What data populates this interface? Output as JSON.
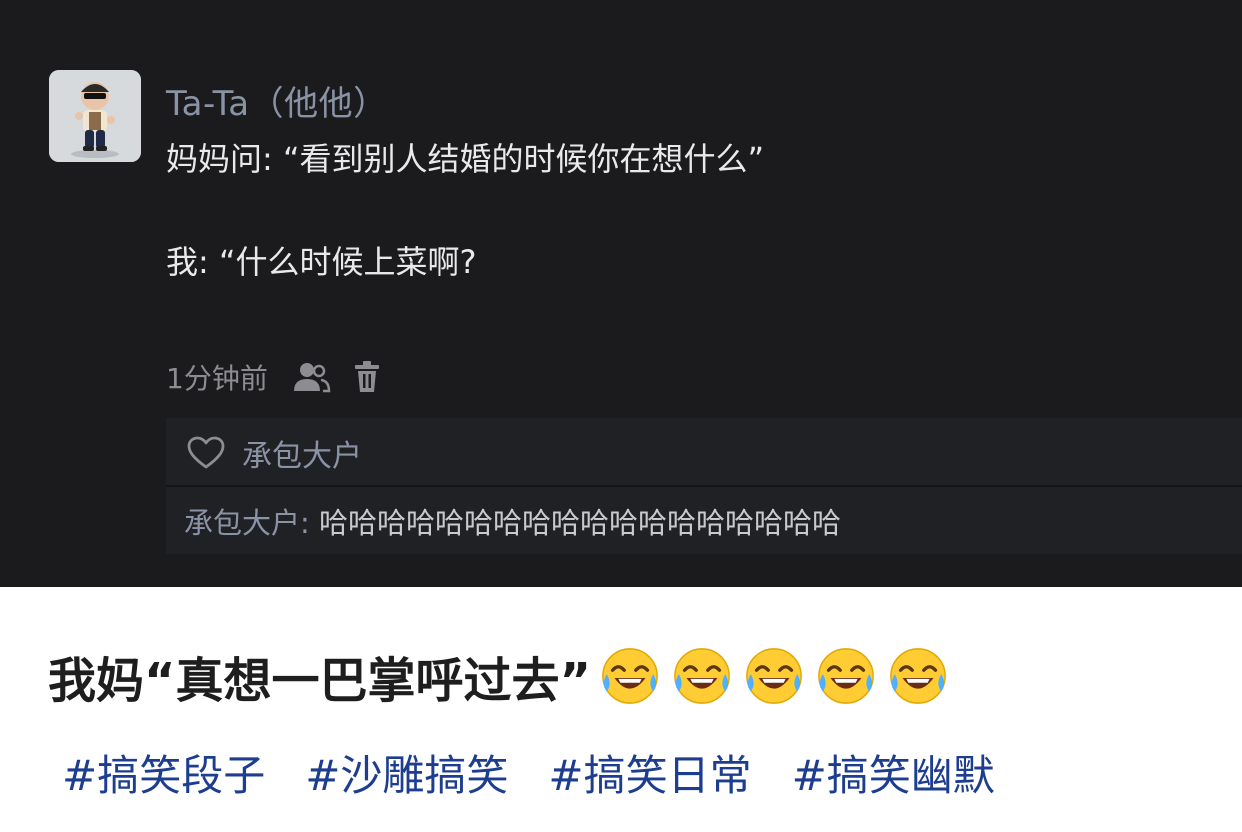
{
  "post": {
    "author": "Ta-Ta（他他）",
    "line1": "妈妈问: “看到别人结婚的时候你在想什么”",
    "line2": "我: “什么时候上菜啊?",
    "time": "1分钟前",
    "icons": [
      "people-icon",
      "trash-icon"
    ]
  },
  "interactions": {
    "liker_name": "承包大户",
    "comment_author": "承包大户",
    "comment_separator": ": ",
    "comment_text": "哈哈哈哈哈哈哈哈哈哈哈哈哈哈哈哈哈哈"
  },
  "caption": {
    "text": "我妈“真想一巴掌呼过去”",
    "emoji": "face-with-tears-of-joy",
    "emoji_count": 5
  },
  "hashtags": [
    "#搞笑段子",
    "#沙雕搞笑",
    "#搞笑日常",
    "#搞笑幽默"
  ],
  "colors": {
    "panel_bg": "#1b1b1d",
    "username": "#8a93a6",
    "hashtag": "#1d3d8f"
  }
}
